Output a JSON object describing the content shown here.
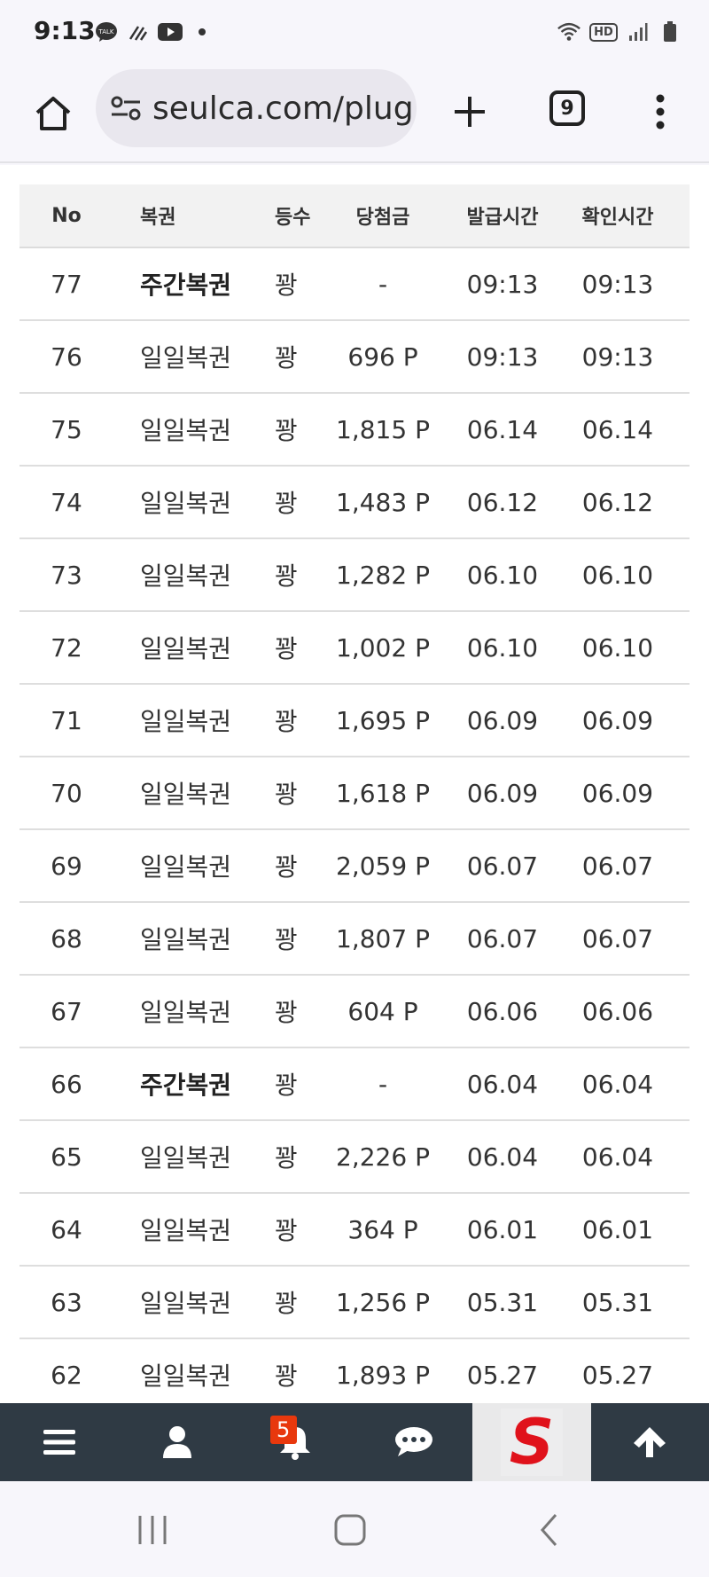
{
  "status_bar": {
    "time": "9:13",
    "left_icons": [
      "kakaotalk-icon",
      "signal-lines-icon",
      "youtube-icon",
      "dot-icon"
    ],
    "right_icons": [
      "wifi-icon",
      "hd-icon",
      "cell-signal-icon",
      "battery-icon"
    ],
    "hd_label": "HD"
  },
  "browser": {
    "url": "seulca.com/plug",
    "tab_count": "9"
  },
  "table": {
    "headers": [
      "No",
      "복권",
      "등수",
      "당첨금",
      "발급시간",
      "확인시간"
    ],
    "rows": [
      {
        "no": "77",
        "type": "주간복권",
        "rank": "꽝",
        "prize": "-",
        "issued": "09:13",
        "checked": "09:13",
        "bold": true
      },
      {
        "no": "76",
        "type": "일일복권",
        "rank": "꽝",
        "prize": "696 P",
        "issued": "09:13",
        "checked": "09:13",
        "bold": false
      },
      {
        "no": "75",
        "type": "일일복권",
        "rank": "꽝",
        "prize": "1,815 P",
        "issued": "06.14",
        "checked": "06.14",
        "bold": false
      },
      {
        "no": "74",
        "type": "일일복권",
        "rank": "꽝",
        "prize": "1,483 P",
        "issued": "06.12",
        "checked": "06.12",
        "bold": false
      },
      {
        "no": "73",
        "type": "일일복권",
        "rank": "꽝",
        "prize": "1,282 P",
        "issued": "06.10",
        "checked": "06.10",
        "bold": false
      },
      {
        "no": "72",
        "type": "일일복권",
        "rank": "꽝",
        "prize": "1,002 P",
        "issued": "06.10",
        "checked": "06.10",
        "bold": false
      },
      {
        "no": "71",
        "type": "일일복권",
        "rank": "꽝",
        "prize": "1,695 P",
        "issued": "06.09",
        "checked": "06.09",
        "bold": false
      },
      {
        "no": "70",
        "type": "일일복권",
        "rank": "꽝",
        "prize": "1,618 P",
        "issued": "06.09",
        "checked": "06.09",
        "bold": false
      },
      {
        "no": "69",
        "type": "일일복권",
        "rank": "꽝",
        "prize": "2,059 P",
        "issued": "06.07",
        "checked": "06.07",
        "bold": false
      },
      {
        "no": "68",
        "type": "일일복권",
        "rank": "꽝",
        "prize": "1,807 P",
        "issued": "06.07",
        "checked": "06.07",
        "bold": false
      },
      {
        "no": "67",
        "type": "일일복권",
        "rank": "꽝",
        "prize": "604 P",
        "issued": "06.06",
        "checked": "06.06",
        "bold": false
      },
      {
        "no": "66",
        "type": "주간복권",
        "rank": "꽝",
        "prize": "-",
        "issued": "06.04",
        "checked": "06.04",
        "bold": true
      },
      {
        "no": "65",
        "type": "일일복권",
        "rank": "꽝",
        "prize": "2,226 P",
        "issued": "06.04",
        "checked": "06.04",
        "bold": false
      },
      {
        "no": "64",
        "type": "일일복권",
        "rank": "꽝",
        "prize": "364 P",
        "issued": "06.01",
        "checked": "06.01",
        "bold": false
      },
      {
        "no": "63",
        "type": "일일복권",
        "rank": "꽝",
        "prize": "1,256 P",
        "issued": "05.31",
        "checked": "05.31",
        "bold": false
      },
      {
        "no": "62",
        "type": "일일복권",
        "rank": "꽝",
        "prize": "1,893 P",
        "issued": "05.27",
        "checked": "05.27",
        "bold": false
      }
    ]
  },
  "toolbar": {
    "items": [
      "menu-icon",
      "user-icon",
      "bell-icon",
      "chat-icon",
      "site-logo",
      "arrow-up-icon"
    ],
    "notification_count": "5",
    "logo_letter": "S"
  },
  "colors": {
    "toolbar_bg": "#2f3a44",
    "badge": "#e8380d",
    "logo_red": "#e0121b"
  }
}
